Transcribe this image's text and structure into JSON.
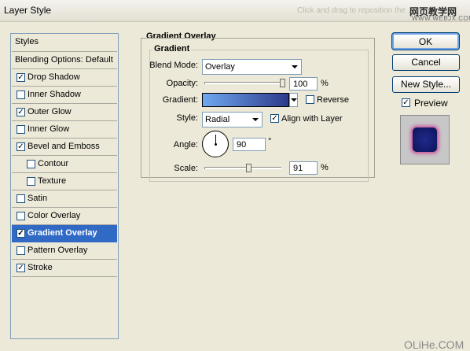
{
  "window": {
    "title": "Layer Style",
    "hint": "Click and drag to reposition the ...",
    "watermark_cn": "网页教学网",
    "watermark_url": "WWW.WEBJX.COM",
    "corner_watermark": "OLiHe.COM"
  },
  "styles_panel": {
    "header": "Styles",
    "blending_options": "Blending Options: Default",
    "items": [
      {
        "label": "Drop Shadow",
        "checked": true
      },
      {
        "label": "Inner Shadow",
        "checked": false
      },
      {
        "label": "Outer Glow",
        "checked": true
      },
      {
        "label": "Inner Glow",
        "checked": false
      },
      {
        "label": "Bevel and Emboss",
        "checked": true
      },
      {
        "label": "Contour",
        "checked": false,
        "sub": true
      },
      {
        "label": "Texture",
        "checked": false,
        "sub": true
      },
      {
        "label": "Satin",
        "checked": false
      },
      {
        "label": "Color Overlay",
        "checked": false
      },
      {
        "label": "Gradient Overlay",
        "checked": true,
        "selected": true
      },
      {
        "label": "Pattern Overlay",
        "checked": false
      },
      {
        "label": "Stroke",
        "checked": true
      }
    ]
  },
  "gradient_overlay": {
    "section_title": "Gradient Overlay",
    "group_title": "Gradient",
    "blend_mode_label": "Blend Mode:",
    "blend_mode": "Overlay",
    "opacity_label": "Opacity:",
    "opacity": "100",
    "opacity_unit": "%",
    "opacity_fraction": 1.0,
    "gradient_label": "Gradient:",
    "gradient_colors": [
      "#6fa8f0",
      "#2c3a8a"
    ],
    "reverse_label": "Reverse",
    "reverse_checked": false,
    "style_label": "Style:",
    "style": "Radial",
    "align_label": "Align with Layer",
    "align_checked": true,
    "angle_label": "Angle:",
    "angle": "90",
    "angle_unit": "°",
    "scale_label": "Scale:",
    "scale": "91",
    "scale_unit": "%",
    "scale_fraction": 0.55
  },
  "buttons": {
    "ok": "OK",
    "cancel": "Cancel",
    "new_style": "New Style...",
    "preview_label": "Preview",
    "preview_checked": true
  },
  "colors": {
    "accent": "#316ac5",
    "preview_fill": "#1f2a8a",
    "preview_glow": "#d04a9a"
  }
}
